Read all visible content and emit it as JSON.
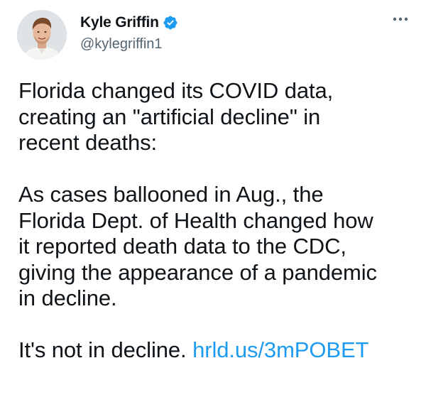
{
  "author": {
    "display_name": "Kyle Griffin",
    "handle": "@kylegriffin1",
    "verified": true,
    "avatar": "profile-photo",
    "verified_color": "#1d9bf0"
  },
  "menu": {
    "icon": "more-dots-icon"
  },
  "tweet": {
    "para1_line1": "Florida changed its COVID data,",
    "para1_line2": "creating an \"artificial decline\" in",
    "para1_line3": "recent deaths:",
    "para2_line1": "As cases ballooned in Aug., the",
    "para2_line2": "Florida Dept. of Health changed how",
    "para2_line3": "it reported death data to the CDC,",
    "para2_line4": "giving the appearance of a pandemic",
    "para2_line5": "in decline.",
    "para3_text": "It's not in decline. ",
    "link_text": "hrld.us/3mPOBET",
    "link_color": "#1d9bf0"
  }
}
